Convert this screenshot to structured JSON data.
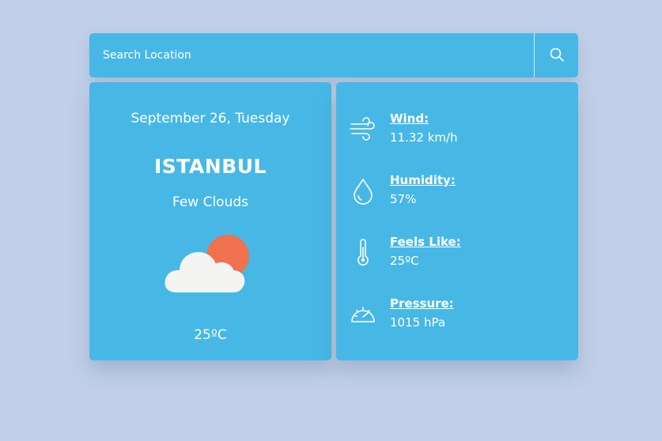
{
  "search": {
    "placeholder": "Search Location",
    "button_icon": "search-icon"
  },
  "weather": {
    "date": "September 26, Tuesday",
    "city": "ISTANBUL",
    "condition": "Few Clouds",
    "condition_icon": "cloud-sun-icon",
    "temperature": "25ºC"
  },
  "details": [
    {
      "icon": "wind-icon",
      "label": "Wind:",
      "value": "11.32 km/h"
    },
    {
      "icon": "droplet-icon",
      "label": "Humidity:",
      "value": "57%"
    },
    {
      "icon": "thermometer-icon",
      "label": "Feels Like:",
      "value": "25ºC"
    },
    {
      "icon": "gauge-icon",
      "label": "Pressure:",
      "value": "1015 hPa"
    }
  ],
  "colors": {
    "background": "#c1d0e8",
    "card": "#47b8e6",
    "text": "#ffffff",
    "sun": "#ef7150",
    "cloud": "#f4f4f2"
  }
}
